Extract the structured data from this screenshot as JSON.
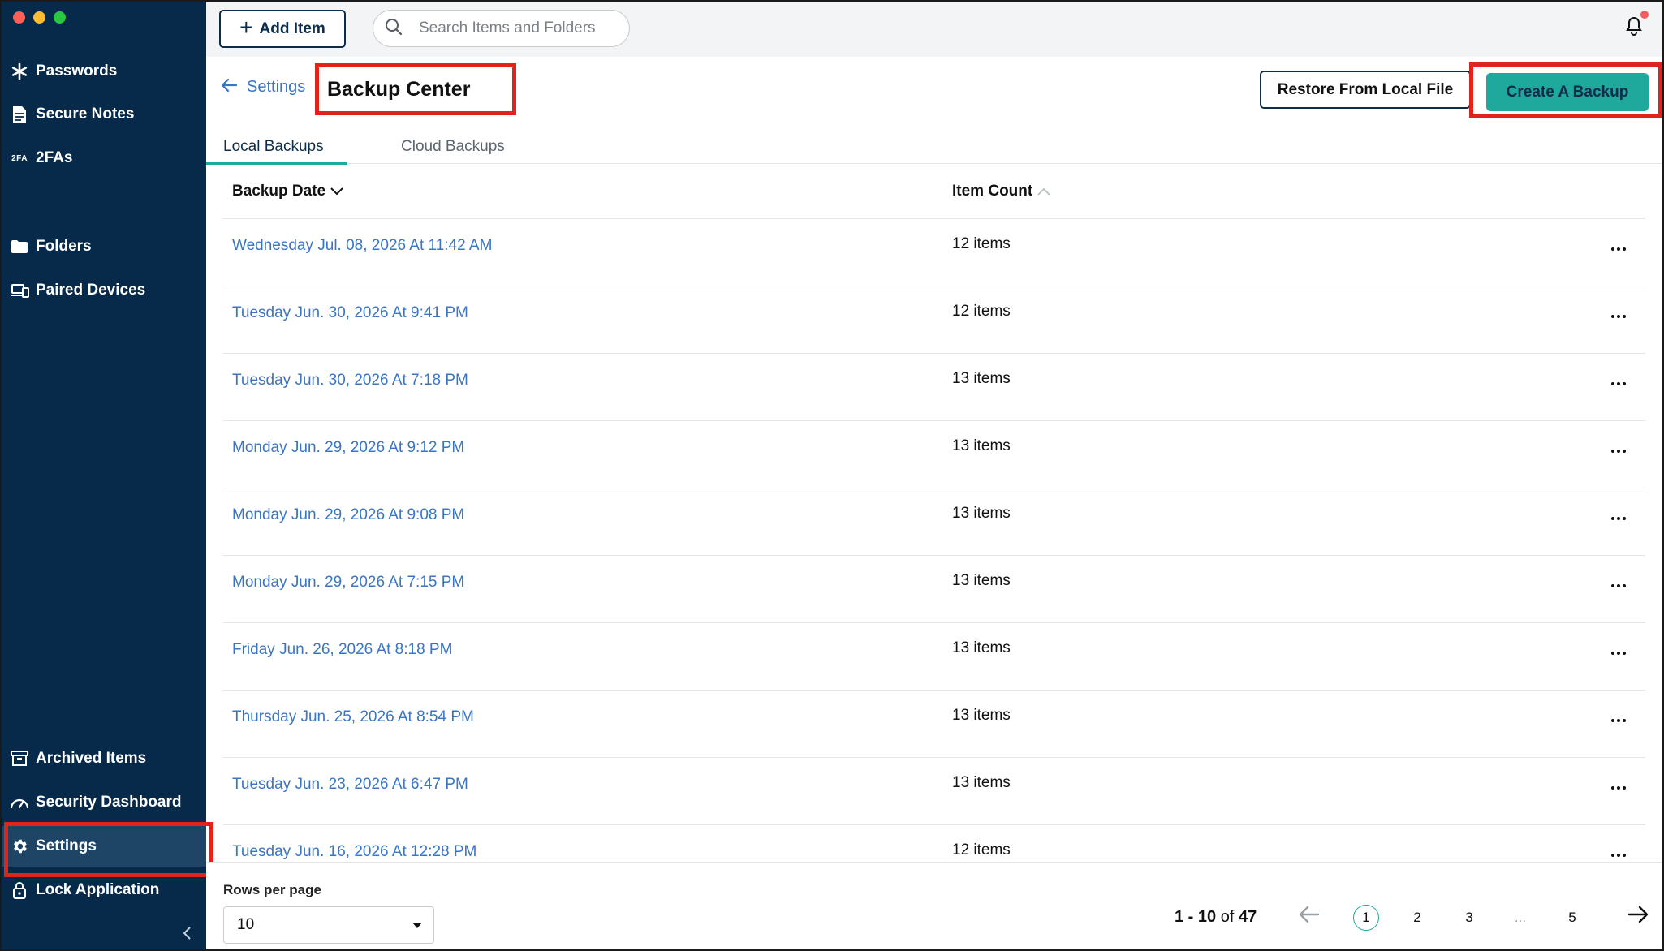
{
  "window": {
    "controls": [
      "close",
      "minimize",
      "maximize"
    ]
  },
  "sidebar": {
    "items": [
      {
        "label": "Passwords",
        "icon": "asterisk-icon"
      },
      {
        "label": "Secure Notes",
        "icon": "note-icon"
      },
      {
        "label": "2FAs",
        "icon": "2fa-icon",
        "icon_text": "2FA"
      },
      {
        "label": "Folders",
        "icon": "folder-icon"
      },
      {
        "label": "Paired Devices",
        "icon": "devices-icon"
      },
      {
        "label": "Archived Items",
        "icon": "archive-icon"
      },
      {
        "label": "Security Dashboard",
        "icon": "gauge-icon"
      },
      {
        "label": "Settings",
        "icon": "gear-icon",
        "active": true
      },
      {
        "label": "Lock Application",
        "icon": "lock-icon"
      }
    ],
    "collapse_icon": "chevron-left-icon"
  },
  "topbar": {
    "add_item_label": "Add Item",
    "search_placeholder": "Search Items and Folders",
    "notification_icon": "bell-icon"
  },
  "header": {
    "back_label": "Settings",
    "title": "Backup Center",
    "restore_label": "Restore From Local File",
    "create_label": "Create A Backup"
  },
  "tabs": [
    {
      "label": "Local Backups",
      "active": true
    },
    {
      "label": "Cloud Backups",
      "active": false
    }
  ],
  "table": {
    "columns": [
      "Backup Date",
      "Item Count"
    ],
    "rows": [
      {
        "date": "Wednesday Jul. 08, 2026 At 11:42 AM",
        "count": "12 items"
      },
      {
        "date": "Tuesday Jun. 30, 2026 At 9:41 PM",
        "count": "12 items"
      },
      {
        "date": "Tuesday Jun. 30, 2026 At 7:18 PM",
        "count": "13 items"
      },
      {
        "date": "Monday Jun. 29, 2026 At 9:12 PM",
        "count": "13 items"
      },
      {
        "date": "Monday Jun. 29, 2026 At 9:08 PM",
        "count": "13 items"
      },
      {
        "date": "Monday Jun. 29, 2026 At 7:15 PM",
        "count": "13 items"
      },
      {
        "date": "Friday Jun. 26, 2026 At 8:18 PM",
        "count": "13 items"
      },
      {
        "date": "Thursday Jun. 25, 2026 At 8:54 PM",
        "count": "13 items"
      },
      {
        "date": "Tuesday Jun. 23, 2026 At 6:47 PM",
        "count": "13 items"
      },
      {
        "date": "Tuesday Jun. 16, 2026 At 12:28 PM",
        "count": "12 items"
      }
    ]
  },
  "footer": {
    "rows_per_page_label": "Rows per page",
    "rows_per_page_value": "10",
    "range_text": "1 - 10",
    "range_of": "of",
    "range_total": "47",
    "pages": [
      "1",
      "2",
      "3",
      "...",
      "5"
    ],
    "current_page": "1"
  },
  "colors": {
    "sidebar_bg": "#072a4a",
    "accent_teal": "#1fa99c",
    "link_blue": "#3a75c4",
    "highlight_red": "#e0231b"
  }
}
